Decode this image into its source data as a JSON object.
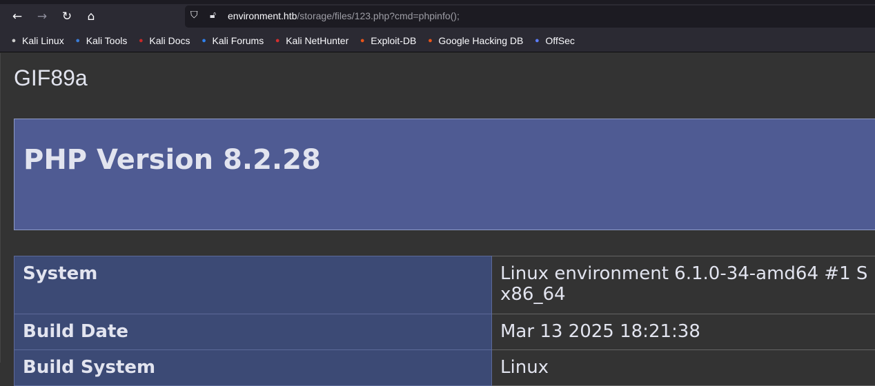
{
  "browser": {
    "url_host": "environment.htb",
    "url_path": "/storage/files/123.php?cmd=phpinfo();",
    "bookmarks": [
      {
        "label": "Kali Linux",
        "icon": "kali-dragon-icon",
        "color": "#cccccc"
      },
      {
        "label": "Kali Tools",
        "icon": "kali-tools-icon",
        "color": "#3a7bd5"
      },
      {
        "label": "Kali Docs",
        "icon": "kali-docs-icon",
        "color": "#c62828"
      },
      {
        "label": "Kali Forums",
        "icon": "kali-forums-icon",
        "color": "#2f80ed"
      },
      {
        "label": "Kali NetHunter",
        "icon": "nethunter-icon",
        "color": "#d32f2f"
      },
      {
        "label": "Exploit-DB",
        "icon": "exploit-db-bug-icon",
        "color": "#e8541a"
      },
      {
        "label": "Google Hacking DB",
        "icon": "ghdb-bug-icon",
        "color": "#e8541a"
      },
      {
        "label": "OffSec",
        "icon": "offsec-icon",
        "color": "#5c7cfa"
      }
    ]
  },
  "page": {
    "prefix": "GIF89a",
    "title": "PHP Version 8.2.28",
    "rows": [
      {
        "key": "System",
        "value": "Linux environment 6.1.0-34-amd64 #1 S",
        "value2": "x86_64"
      },
      {
        "key": "Build Date",
        "value": "Mar 13 2025 18:21:38"
      },
      {
        "key": "Build System",
        "value": "Linux"
      }
    ]
  }
}
